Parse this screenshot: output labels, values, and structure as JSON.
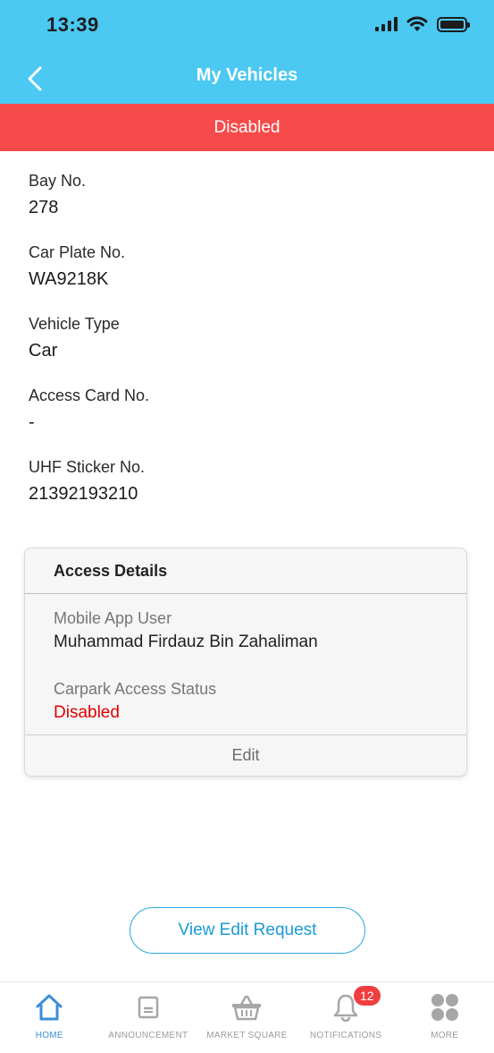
{
  "status_bar": {
    "time": "13:39"
  },
  "header": {
    "title": "My Vehicles"
  },
  "banner": {
    "status": "Disabled"
  },
  "vehicle": {
    "fields": [
      {
        "label": "Bay No.",
        "value": "278"
      },
      {
        "label": "Car Plate No.",
        "value": "WA9218K"
      },
      {
        "label": "Vehicle Type",
        "value": "Car"
      },
      {
        "label": "Access Card No.",
        "value": "-"
      },
      {
        "label": "UHF Sticker No.",
        "value": "21392193210"
      }
    ]
  },
  "access_details": {
    "title": "Access Details",
    "mobile_user_label": "Mobile App User",
    "mobile_user_value": "Muhammad Firdauz Bin Zahaliman",
    "carpark_status_label": "Carpark Access Status",
    "carpark_status_value": "Disabled",
    "edit_label": "Edit"
  },
  "actions": {
    "view_edit_request": "View Edit Request"
  },
  "bottom_nav": {
    "items": [
      {
        "label": "HOME",
        "icon": "home-icon",
        "active": true
      },
      {
        "label": "ANNOUNCEMENT",
        "icon": "announcement-icon"
      },
      {
        "label": "MARKET SQUARE",
        "icon": "basket-icon"
      },
      {
        "label": "NOTIFICATIONS",
        "icon": "bell-icon",
        "badge": "12"
      },
      {
        "label": "MORE",
        "icon": "more-icon"
      }
    ]
  },
  "colors": {
    "header": "#4bc9f2",
    "banner": "#f74a4a",
    "danger_text": "#e00000",
    "accent": "#1a9ad8"
  }
}
